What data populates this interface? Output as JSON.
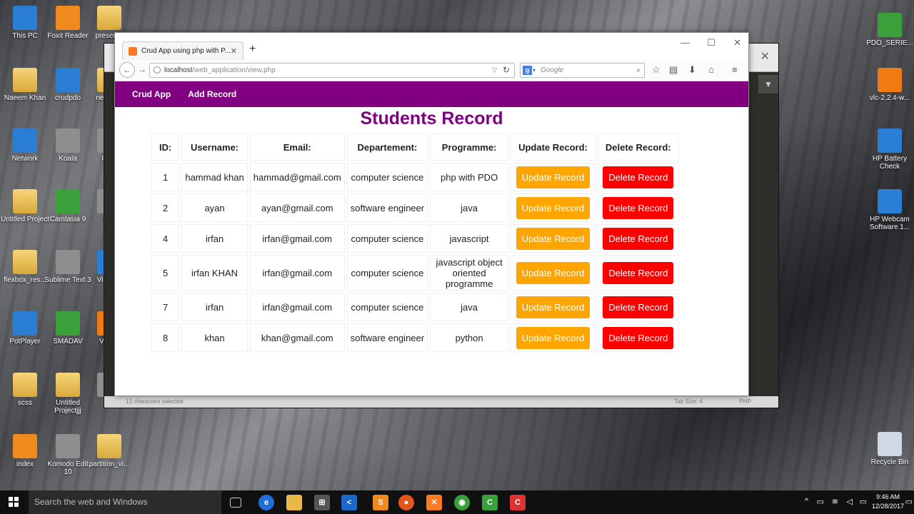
{
  "desktop": {
    "icons_left": [
      {
        "label": "This PC",
        "icon": "computer-icon"
      },
      {
        "label": "Foxit Reader",
        "icon": "pdf-icon"
      },
      {
        "label": "presenta",
        "icon": "folder-icon"
      },
      {
        "label": "Naeem Khan",
        "icon": "user-folder-icon"
      },
      {
        "label": "crudpdo",
        "icon": "vscode-file-icon"
      },
      {
        "label": "new con",
        "icon": "folder-icon"
      },
      {
        "label": "Network",
        "icon": "network-icon"
      },
      {
        "label": "Koala",
        "icon": "koala-icon"
      },
      {
        "label": "Cont",
        "icon": "app-icon"
      },
      {
        "label": "Untitled Project",
        "icon": "folder-icon"
      },
      {
        "label": "Camtasia 9",
        "icon": "camtasia-icon"
      },
      {
        "label": "M F",
        "icon": "app-icon"
      },
      {
        "label": "flexbox_res...",
        "icon": "folder-icon"
      },
      {
        "label": "Sublime Text 3",
        "icon": "sublime-icon"
      },
      {
        "label": "Visua C",
        "icon": "vscode-icon"
      },
      {
        "label": "PotPlayer",
        "icon": "potplayer-icon"
      },
      {
        "label": "SMADAV",
        "icon": "smadav-icon"
      },
      {
        "label": "VLC p",
        "icon": "vlc-icon"
      },
      {
        "label": "scss",
        "icon": "folder-icon"
      },
      {
        "label": "Untitled Projectjjj",
        "icon": "folder-icon"
      },
      {
        "label": "A",
        "icon": "app-icon"
      },
      {
        "label": "index",
        "icon": "sublime-file-icon"
      },
      {
        "label": "Komodo Edit 10",
        "icon": "komodo-icon"
      },
      {
        "label": "partition_vi...",
        "icon": "folder-icon"
      }
    ],
    "icons_right": [
      {
        "label": "PDO_SERIE...",
        "icon": "spreadsheet-icon"
      },
      {
        "label": "vlc-2.2.4-w...",
        "icon": "vlc-icon"
      },
      {
        "label": "HP Battery Check",
        "icon": "hp-icon"
      },
      {
        "label": "HP Webcam Software 1...",
        "icon": "hp-icon"
      },
      {
        "label": "Recycle Bin",
        "icon": "recycle-bin-icon"
      }
    ]
  },
  "sublime": {
    "status_left": "13 characters selected",
    "status_tab": "Tab Size: 4",
    "status_syntax": "PHP"
  },
  "browser": {
    "tab_title": "Crud App using php with P...",
    "url_host": "localhost",
    "url_path": "/web_application/view.php",
    "search_placeholder": "Google",
    "search_engine_letter": "g"
  },
  "page": {
    "nav": [
      "Crud App",
      "Add Record"
    ],
    "title": "Students Record",
    "columns": [
      "ID:",
      "Username:",
      "Email:",
      "Departement:",
      "Programme:",
      "Update Record:",
      "Delete Record:"
    ],
    "update_label": "Update Record",
    "delete_label": "Delete Record",
    "rows": [
      {
        "id": "1",
        "username": "hammad khan",
        "email": "hammad@gmail.com",
        "dept": "computer science",
        "prog": "php with PDO"
      },
      {
        "id": "2",
        "username": "ayan",
        "email": "ayan@gmail.com",
        "dept": "software engineer",
        "prog": "java"
      },
      {
        "id": "4",
        "username": "irfan",
        "email": "irfan@gmail.com",
        "dept": "computer science",
        "prog": "javascript"
      },
      {
        "id": "5",
        "username": "irfan KHAN",
        "email": "irfan@gmail.com",
        "dept": "computer science",
        "prog": "javascript object oriented programme"
      },
      {
        "id": "7",
        "username": "irfan",
        "email": "irfan@gmail.com",
        "dept": "computer science",
        "prog": "java"
      },
      {
        "id": "8",
        "username": "khan",
        "email": "khan@gmail.com",
        "dept": "software engineer",
        "prog": "python"
      }
    ],
    "colors": {
      "brand": "#800080",
      "update": "#ffa500",
      "delete": "#ff0000"
    }
  },
  "taskbar": {
    "search_placeholder": "Search the web and Windows",
    "time": "9:46 AM",
    "date": "12/28/2017"
  }
}
